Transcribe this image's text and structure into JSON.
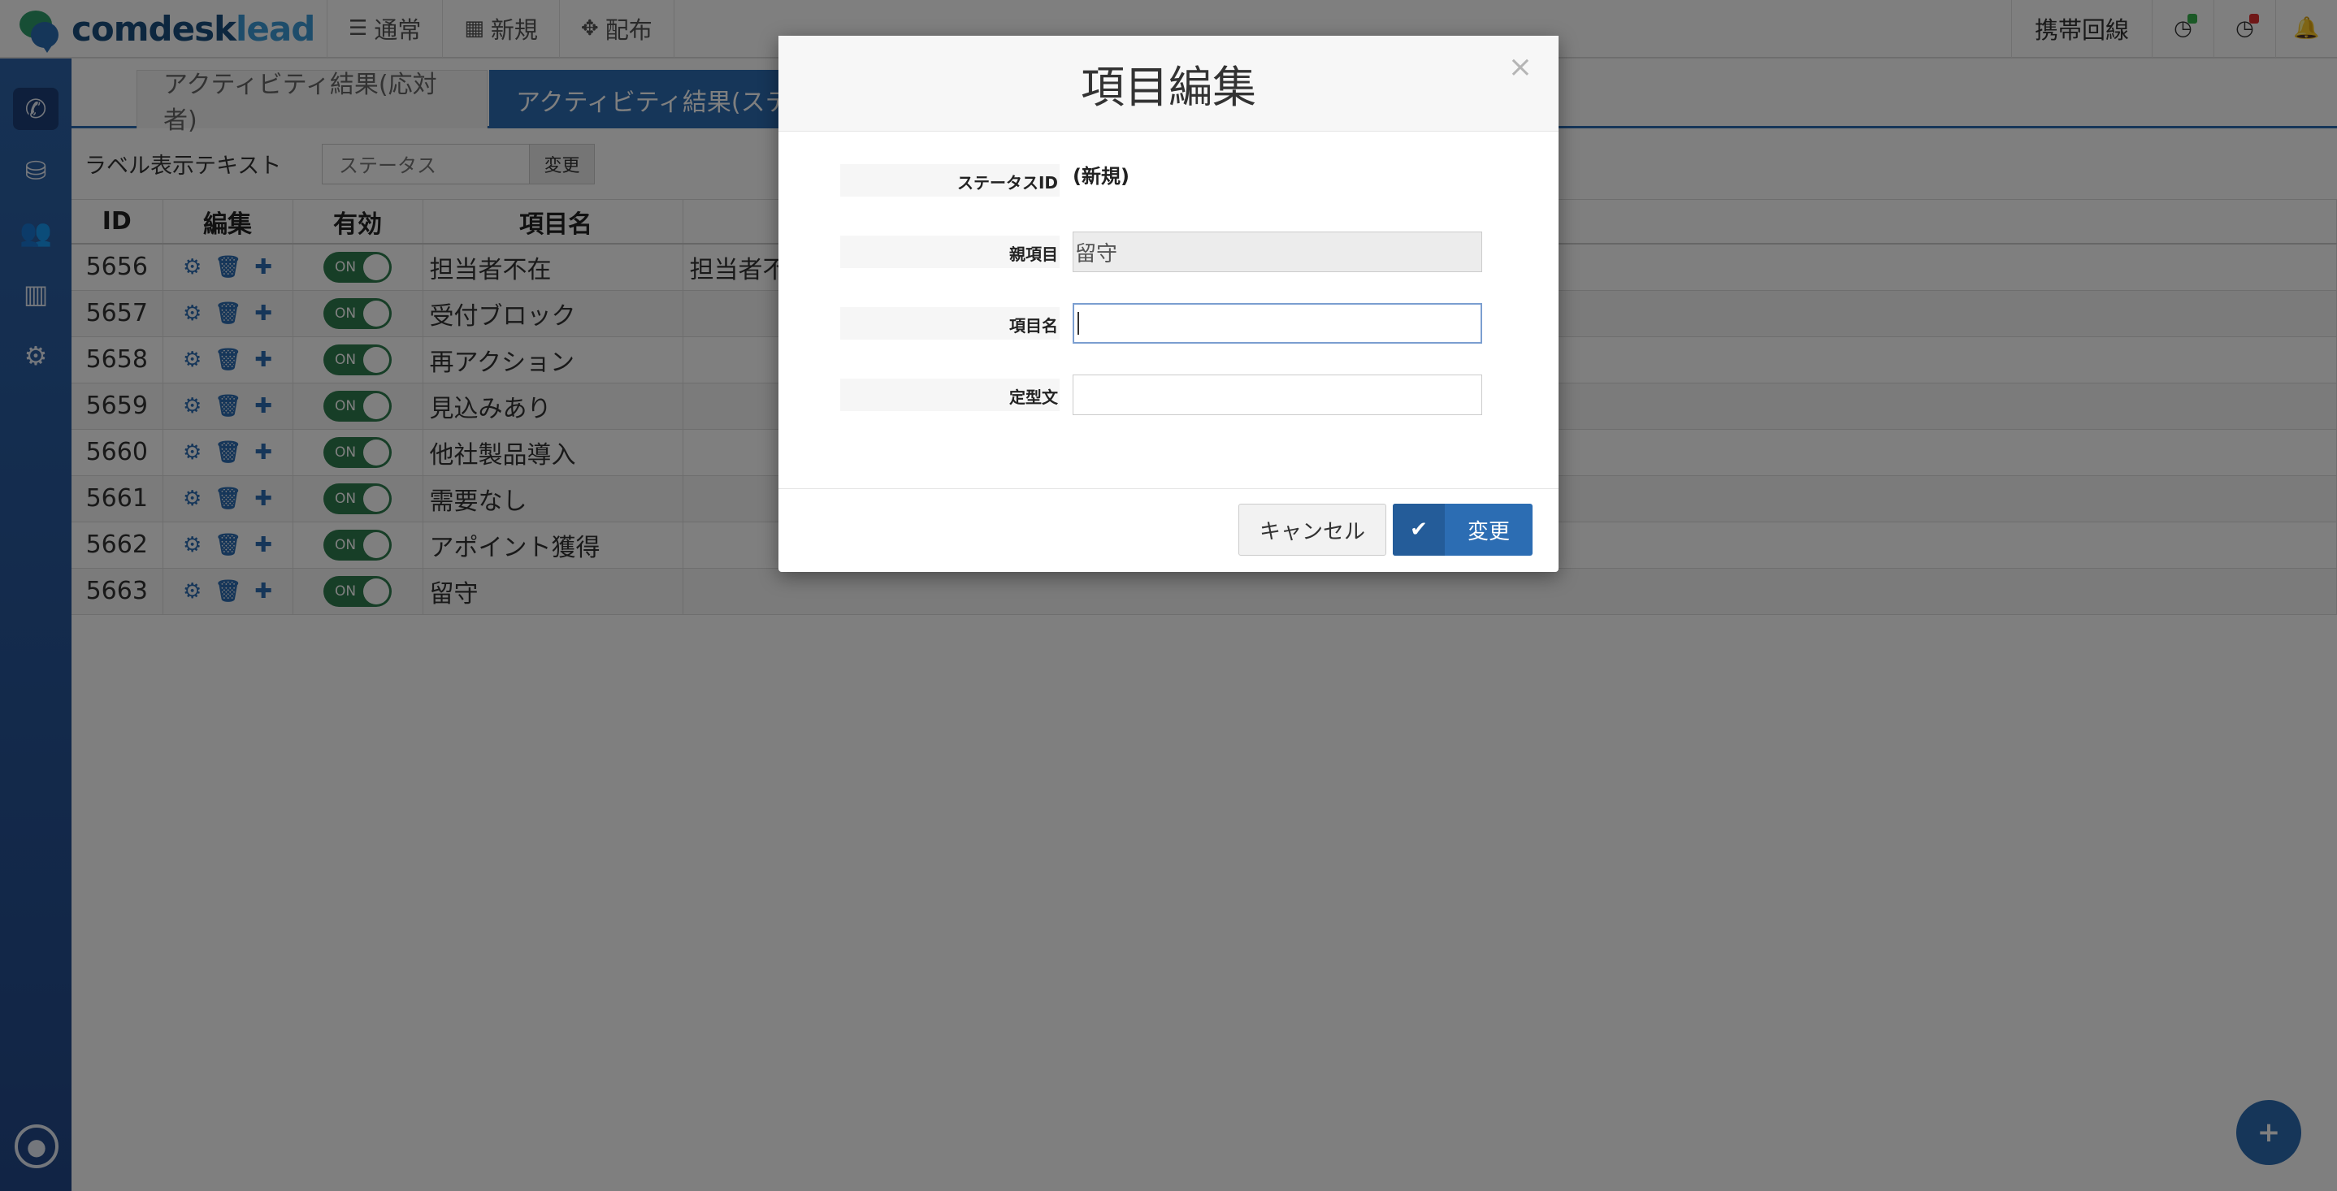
{
  "brand": {
    "name": "comdesk",
    "suffix": "lead",
    "accent": "#2c6db3"
  },
  "nav": [
    {
      "label": "通常",
      "icon": "list-icon"
    },
    {
      "label": "新規",
      "icon": "grid-icon"
    },
    {
      "label": "配布",
      "icon": "expand-icon"
    }
  ],
  "header_right": {
    "line_label": "携帯回線"
  },
  "sidebar": [
    {
      "icon": "phone-icon"
    },
    {
      "icon": "database-icon"
    },
    {
      "icon": "users-icon"
    },
    {
      "icon": "bar-chart-icon"
    },
    {
      "icon": "gear-icon"
    }
  ],
  "tabs": [
    {
      "label": "アクティビティ結果(応対者)"
    },
    {
      "label": "アクティビティ結果(ステ"
    }
  ],
  "label_setting": {
    "label": "ラベル表示テキスト",
    "value": "ステータス",
    "button": "変更"
  },
  "table": {
    "headers": [
      "ID",
      "編集",
      "有効",
      "項目名"
    ],
    "rows": [
      {
        "id": "5656",
        "toggle": "ON",
        "name": "担当者不在",
        "text": "担当者不"
      },
      {
        "id": "5657",
        "toggle": "ON",
        "name": "受付ブロック",
        "text": ""
      },
      {
        "id": "5658",
        "toggle": "ON",
        "name": "再アクション",
        "text": ""
      },
      {
        "id": "5659",
        "toggle": "ON",
        "name": "見込みあり",
        "text": ""
      },
      {
        "id": "5660",
        "toggle": "ON",
        "name": "他社製品導入",
        "text": ""
      },
      {
        "id": "5661",
        "toggle": "ON",
        "name": "需要なし",
        "text": ""
      },
      {
        "id": "5662",
        "toggle": "ON",
        "name": "アポイント獲得",
        "text": ""
      },
      {
        "id": "5663",
        "toggle": "ON",
        "name": "留守",
        "text": ""
      }
    ]
  },
  "modal": {
    "title": "項目編集",
    "close": "×",
    "fields": {
      "status_id": {
        "label": "ステータスID",
        "value": "(新規)"
      },
      "parent": {
        "label": "親項目",
        "value": "留守"
      },
      "name": {
        "label": "項目名",
        "value": ""
      },
      "template": {
        "label": "定型文",
        "value": ""
      }
    },
    "cancel": "キャンセル",
    "submit": "変更"
  },
  "fab": "+"
}
